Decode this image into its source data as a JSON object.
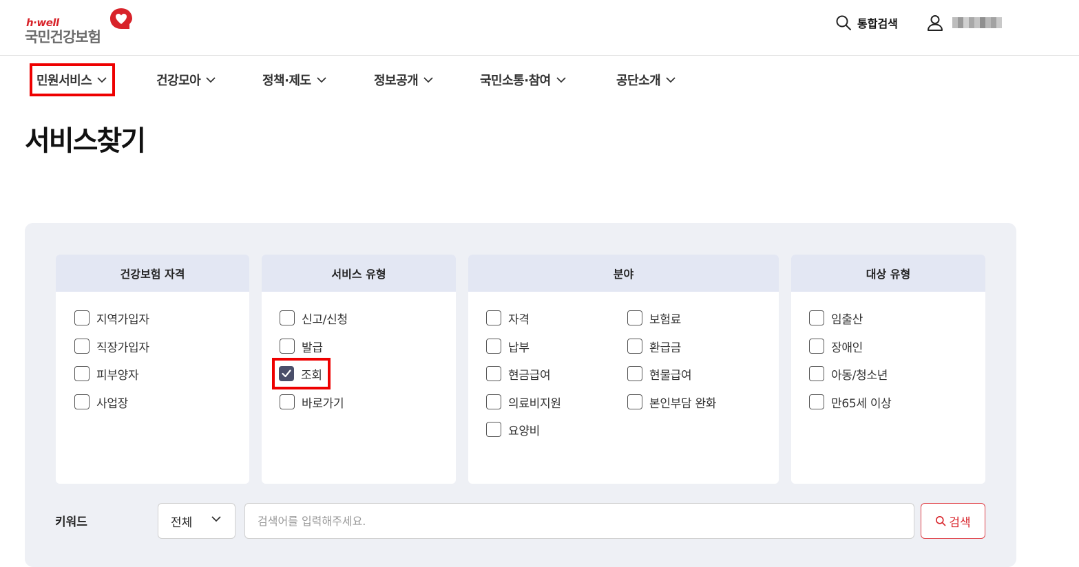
{
  "brand": {
    "logo_sub": "h·well",
    "logo_main": "국민건강보험",
    "accent_color": "#d8232a"
  },
  "header": {
    "search_label": "통합검색",
    "search_icon": "search-icon",
    "user_icon": "user-icon"
  },
  "gnb": {
    "items": [
      {
        "label": "민원서비스"
      },
      {
        "label": "건강모아"
      },
      {
        "label": "정책·제도"
      },
      {
        "label": "정보공개"
      },
      {
        "label": "국민소통·참여"
      },
      {
        "label": "공단소개"
      }
    ]
  },
  "page": {
    "title": "서비스찾기"
  },
  "filters": {
    "eligibility": {
      "title": "건강보험 자격",
      "options": [
        {
          "label": "지역가입자",
          "checked": false
        },
        {
          "label": "직장가입자",
          "checked": false
        },
        {
          "label": "피부양자",
          "checked": false
        },
        {
          "label": "사업장",
          "checked": false
        }
      ]
    },
    "service_type": {
      "title": "서비스 유형",
      "options": [
        {
          "label": "신고/신청",
          "checked": false
        },
        {
          "label": "발급",
          "checked": false
        },
        {
          "label": "조회",
          "checked": true
        },
        {
          "label": "바로가기",
          "checked": false
        }
      ]
    },
    "field": {
      "title": "분야",
      "options": [
        {
          "label": "자격",
          "checked": false
        },
        {
          "label": "보험료",
          "checked": false
        },
        {
          "label": "납부",
          "checked": false
        },
        {
          "label": "환급금",
          "checked": false
        },
        {
          "label": "현금급여",
          "checked": false
        },
        {
          "label": "현물급여",
          "checked": false
        },
        {
          "label": "의료비지원",
          "checked": false
        },
        {
          "label": "본인부담 완화",
          "checked": false
        },
        {
          "label": "요양비",
          "checked": false
        }
      ]
    },
    "target_type": {
      "title": "대상 유형",
      "options": [
        {
          "label": "임출산",
          "checked": false
        },
        {
          "label": "장애인",
          "checked": false
        },
        {
          "label": "아동/청소년",
          "checked": false
        },
        {
          "label": "만65세 이상",
          "checked": false
        }
      ]
    }
  },
  "keyword": {
    "label": "키워드",
    "select_value": "전체",
    "placeholder": "검색어를 입력해주세요.",
    "search_button": "검색"
  }
}
